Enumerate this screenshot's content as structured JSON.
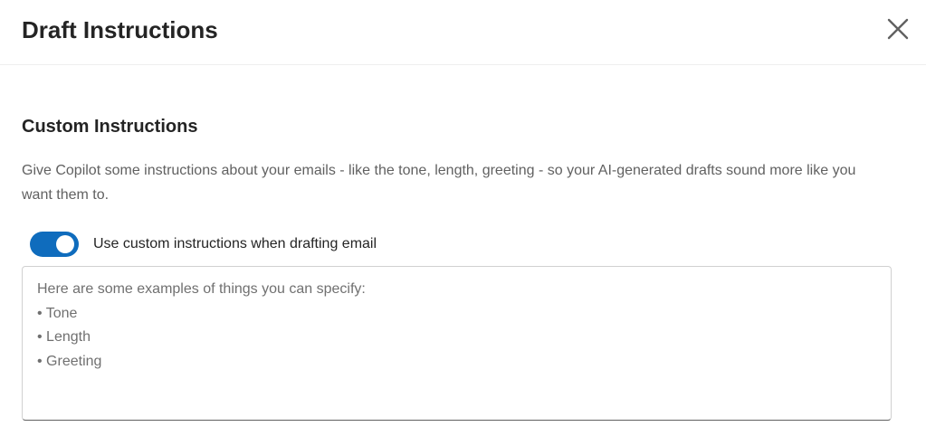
{
  "dialog": {
    "title": "Draft Instructions",
    "close_icon": "close-icon"
  },
  "section": {
    "title": "Custom Instructions",
    "description": "Give Copilot some instructions about your emails - like the tone, length, greeting - so your AI-generated drafts sound more like you want them to."
  },
  "toggle": {
    "label": "Use custom instructions when drafting email",
    "checked": true,
    "accent_color": "#0f6cbd"
  },
  "instructions_input": {
    "value": "",
    "placeholder_lines": [
      "Here are some examples of things you can specify:",
      "• Tone",
      "• Length",
      "• Greeting"
    ]
  }
}
